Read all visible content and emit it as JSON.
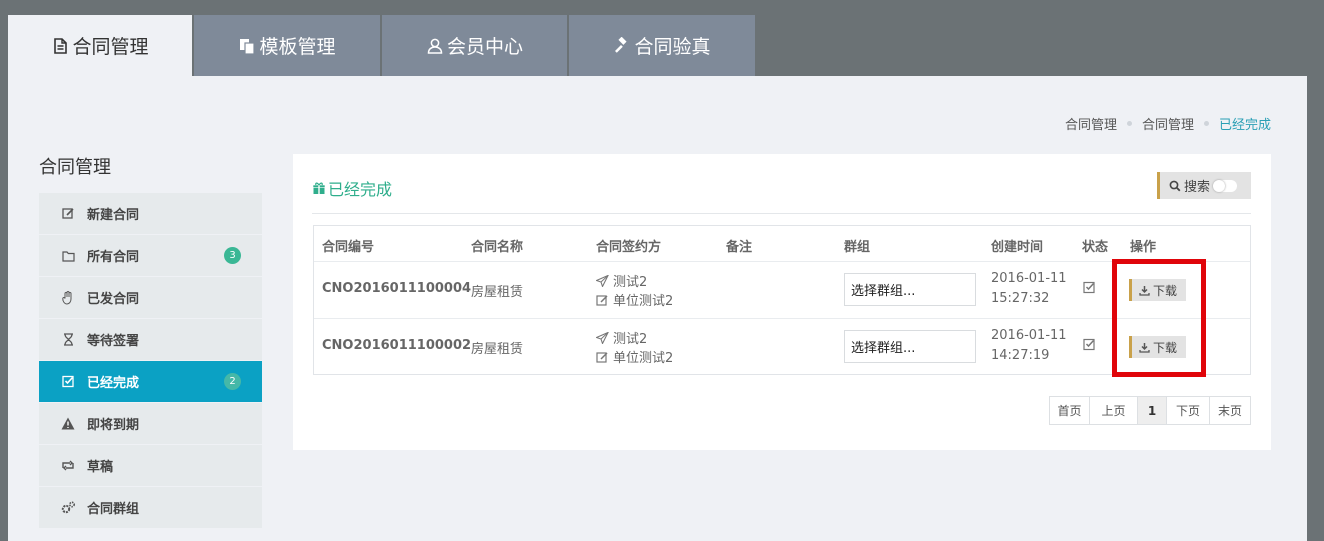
{
  "tabs": [
    {
      "label": "合同管理",
      "icon": "document-icon"
    },
    {
      "label": "模板管理",
      "icon": "copy-icon"
    },
    {
      "label": "会员中心",
      "icon": "user-icon"
    },
    {
      "label": "合同验真",
      "icon": "gavel-icon"
    }
  ],
  "breadcrumb": [
    "合同管理",
    "合同管理",
    "已经完成"
  ],
  "sidebar": {
    "title": "合同管理",
    "items": [
      {
        "label": "新建合同",
        "icon": "edit-icon"
      },
      {
        "label": "所有合同",
        "icon": "folder-icon",
        "badge": "3"
      },
      {
        "label": "已发合同",
        "icon": "hand-icon"
      },
      {
        "label": "等待签署",
        "icon": "hourglass-icon"
      },
      {
        "label": "已经完成",
        "icon": "check-square-icon",
        "badge": "2"
      },
      {
        "label": "即将到期",
        "icon": "warning-icon"
      },
      {
        "label": "草稿",
        "icon": "retweet-icon"
      },
      {
        "label": "合同群组",
        "icon": "cogs-icon"
      }
    ]
  },
  "panel": {
    "title": "已经完成",
    "search_label": "搜索"
  },
  "table": {
    "headers": [
      "合同编号",
      "合同名称",
      "合同签约方",
      "备注",
      "群组",
      "创建时间",
      "状态",
      "操作"
    ],
    "rows": [
      {
        "code": "CNO2016011100004",
        "name": "房屋租赁",
        "signer_send": "测试2",
        "signer_unit": "单位测试2",
        "note": "",
        "group": "选择群组...",
        "date": "2016-01-11",
        "time": "15:27:32",
        "action": "下载"
      },
      {
        "code": "CNO2016011100002",
        "name": "房屋租赁",
        "signer_send": "测试2",
        "signer_unit": "单位测试2",
        "note": "",
        "group": "选择群组...",
        "date": "2016-01-11",
        "time": "14:27:19",
        "action": "下载"
      }
    ]
  },
  "pager": [
    "首页",
    "上页",
    "1",
    "下页",
    "末页"
  ],
  "colors": {
    "accent": "#0ba1c4",
    "green": "#2fae8c",
    "link": "#3d7ab8",
    "highlight": "#e0050a"
  }
}
